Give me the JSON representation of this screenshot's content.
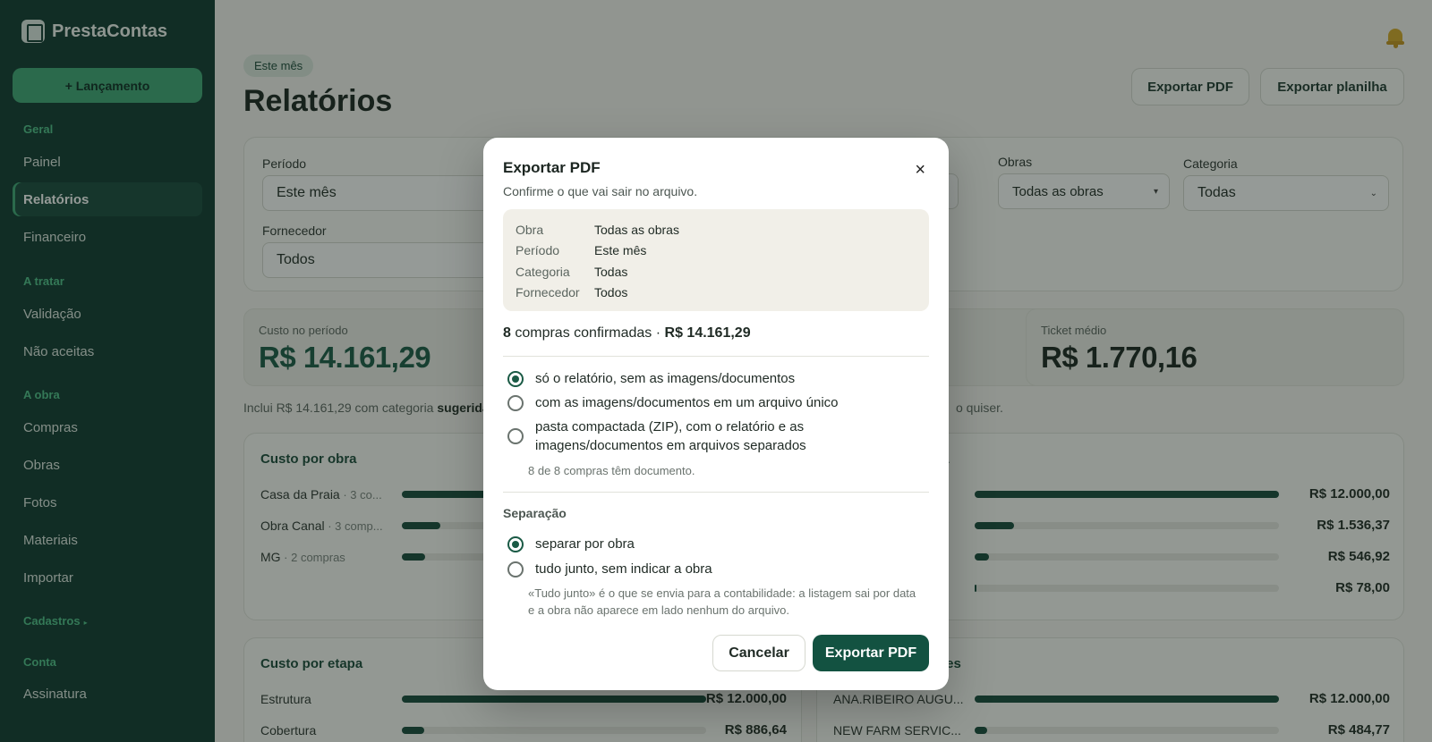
{
  "app": {
    "name": "PrestaContas"
  },
  "sidebar": {
    "new_button": "+ Lançamento",
    "sections": [
      {
        "label": "Geral",
        "items": [
          "Painel",
          "Relatórios",
          "Financeiro"
        ]
      },
      {
        "label": "A tratar",
        "items": [
          "Validação",
          "Não aceitas"
        ]
      },
      {
        "label": "A obra",
        "items": [
          "Compras",
          "Obras",
          "Fotos",
          "Materiais",
          "Importar"
        ]
      },
      {
        "label": "Cadastros",
        "items": []
      },
      {
        "label": "Conta",
        "items": [
          "Assinatura"
        ]
      }
    ],
    "active_item": "Relatórios",
    "cadastros_caret": "▸"
  },
  "header": {
    "period_chip": "Este mês",
    "title": "Relatórios",
    "export_pdf": "Exportar PDF",
    "export_sheet": "Exportar planilha"
  },
  "filters": {
    "periodo_label": "Período",
    "periodo_value": "Este mês",
    "obras_label": "Obras",
    "obras_value": "Todas as obras",
    "categoria_label": "Categoria",
    "categoria_value": "Todas",
    "fornecedor_label": "Fornecedor",
    "fornecedor_value": "Todos"
  },
  "kpis": {
    "custo_label": "Custo no período",
    "custo_value": "R$ 14.161,29",
    "ticket_label": "Ticket médio",
    "ticket_value": "R$ 1.770,16"
  },
  "note": {
    "prefix": "Inclui R$ 14.161,29 com categoria ",
    "bold": "sugerida p",
    "suffix": "o quiser."
  },
  "cards": {
    "custo_obra": {
      "title": "Custo por obra",
      "rows": [
        {
          "label": "Casa da Praia",
          "meta": " · 3 co...",
          "fraction": 1.0
        },
        {
          "label": "Obra Canal",
          "meta": " · 3 comp...",
          "fraction": 0.1
        },
        {
          "label": "MG",
          "meta": " · 2 compras",
          "fraction": 0.06
        }
      ]
    },
    "custo_categoria": {
      "title_fragment": "oria",
      "rows": [
        {
          "value": "R$ 12.000,00",
          "fraction": 1.0
        },
        {
          "value": "R$ 1.536,37",
          "fraction": 0.128
        },
        {
          "value": "R$ 546,92",
          "fraction": 0.046
        },
        {
          "value": "R$ 78,00",
          "fraction": 0.007
        }
      ]
    },
    "custo_etapa": {
      "title": "Custo por etapa",
      "rows": [
        {
          "label": "Estrutura",
          "value": "R$ 12.000,00",
          "fraction": 1.0
        },
        {
          "label": "Cobertura",
          "value": "R$ 886,64",
          "fraction": 0.074
        }
      ]
    },
    "fornecedores": {
      "title_fragment": "dores",
      "rows": [
        {
          "label": "ANA.RIBEIRO AUGU...",
          "value": "R$ 12.000,00",
          "fraction": 1.0
        },
        {
          "label": "NEW FARM SERVIC...",
          "value": "R$ 484,77",
          "fraction": 0.04
        }
      ]
    }
  },
  "modal": {
    "title": "Exportar PDF",
    "subtitle": "Confirme o que vai sair no arquivo.",
    "close": "×",
    "summary": [
      {
        "k": "Obra",
        "v": "Todas as obras"
      },
      {
        "k": "Período",
        "v": "Este mês"
      },
      {
        "k": "Categoria",
        "v": "Todas"
      },
      {
        "k": "Fornecedor",
        "v": "Todos"
      }
    ],
    "count_num": "8",
    "count_text": " compras confirmadas · ",
    "count_total": "R$ 14.161,29",
    "content_options": [
      {
        "label": "só o relatório, sem as imagens/documentos",
        "selected": true
      },
      {
        "label": "com as imagens/documentos em um arquivo único",
        "selected": false
      },
      {
        "label": "pasta compactada (ZIP), com o relatório e as imagens/documentos em arquivos separados",
        "selected": false
      }
    ],
    "docs_hint": "8 de 8 compras têm documento.",
    "separation_label": "Separação",
    "separation_options": [
      {
        "label": "separar por obra",
        "selected": true
      },
      {
        "label": "tudo junto, sem indicar a obra",
        "selected": false
      }
    ],
    "separation_hint": "«Tudo junto» é o que se envia para a contabilidade: a listagem sai por data e a obra não aparece em lado nenhum do arquivo.",
    "cancel": "Cancelar",
    "confirm": "Exportar PDF"
  },
  "colors": {
    "sidebar_bg": "#0f3a30",
    "accent": "#3fa877",
    "primary_button": "#135241",
    "bar_fill": "#174a3b"
  }
}
